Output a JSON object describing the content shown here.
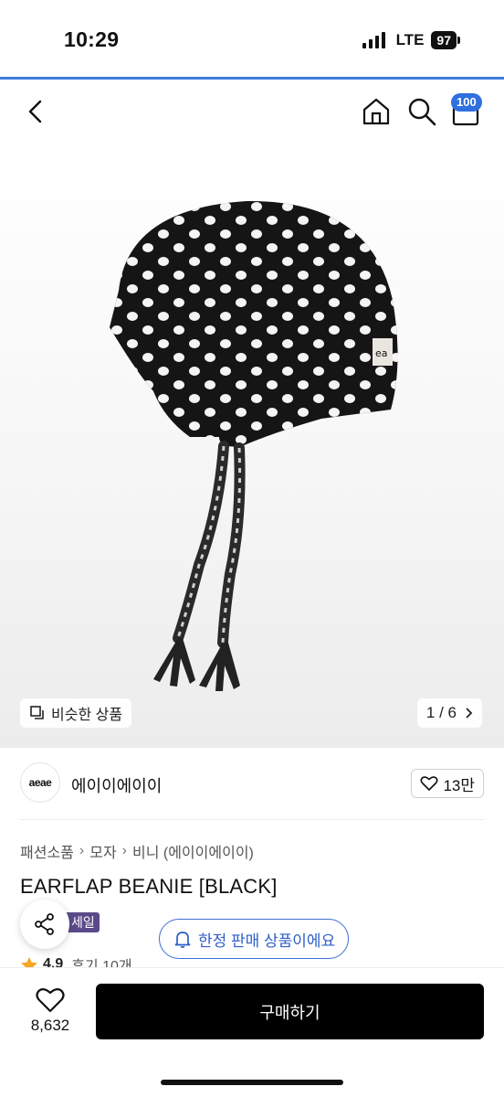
{
  "status_bar": {
    "time": "10:29",
    "network": "LTE",
    "battery": "97"
  },
  "nav": {
    "cart_badge": "100",
    "icons": [
      "back-icon",
      "home-icon",
      "search-icon",
      "cart-icon"
    ]
  },
  "gallery": {
    "similar_label": "비슷한 상품",
    "pager": "1 / 6"
  },
  "store": {
    "logo_text": "aeae",
    "name": "에이이에이이",
    "likes": "13만"
  },
  "product": {
    "breadcrumb": [
      "패션소품",
      "모자",
      "비니 (에이이에이이)"
    ],
    "title": "EARFLAP BEANIE [BLACK]",
    "sale_badge": "세일",
    "limited_notice": "한정 판매 상품이에요",
    "rating": "4.9",
    "reviews": "후기 10개"
  },
  "bottom": {
    "wish_count": "8,632",
    "buy_label": "구매하기"
  },
  "colors": {
    "accent_blue": "#2f6fe0",
    "sale_purple": "#5b4a8a",
    "star": "#f5a623",
    "buy_button": "#000000"
  }
}
